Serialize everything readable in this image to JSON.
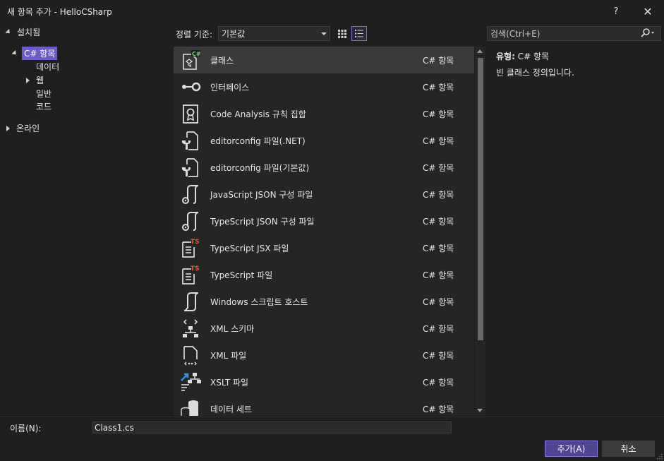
{
  "window": {
    "title": "새 항목 추가 - HelloCSharp",
    "help_label": "?",
    "close_label": "✕"
  },
  "tree": {
    "installed": "설치됨",
    "csharp_items": "C# 항목",
    "data": "데이터",
    "web": "웹",
    "general": "일반",
    "code": "코드",
    "online": "온라인"
  },
  "toolbar": {
    "sort_label": "정렬 기준:",
    "sort_value": "기본값",
    "search_placeholder": "검색(Ctrl+E)"
  },
  "items": [
    {
      "name": "클래스",
      "category": "C# 항목",
      "icon": "class-icon"
    },
    {
      "name": "인터페이스",
      "category": "C# 항목",
      "icon": "interface-icon"
    },
    {
      "name": "Code Analysis 규칙 집합",
      "category": "C# 항목",
      "icon": "ruleset-icon"
    },
    {
      "name": "editorconfig 파일(.NET)",
      "category": "C# 항목",
      "icon": "editorconfig-icon"
    },
    {
      "name": "editorconfig 파일(기본값)",
      "category": "C# 항목",
      "icon": "editorconfig-icon"
    },
    {
      "name": "JavaScript JSON 구성 파일",
      "category": "C# 항목",
      "icon": "script-file-icon"
    },
    {
      "name": "TypeScript JSON 구성 파일",
      "category": "C# 항목",
      "icon": "script-file-icon"
    },
    {
      "name": "TypeScript JSX 파일",
      "category": "C# 항목",
      "icon": "typescript-icon"
    },
    {
      "name": "TypeScript 파일",
      "category": "C# 항목",
      "icon": "typescript-icon"
    },
    {
      "name": "Windows 스크립트 호스트",
      "category": "C# 항목",
      "icon": "script-host-icon"
    },
    {
      "name": "XML 스키마",
      "category": "C# 항목",
      "icon": "xml-schema-icon"
    },
    {
      "name": "XML 파일",
      "category": "C# 항목",
      "icon": "xml-file-icon"
    },
    {
      "name": "XSLT 파일",
      "category": "C# 항목",
      "icon": "xslt-icon"
    },
    {
      "name": "데이터 세트",
      "category": "C# 항목",
      "icon": "dataset-icon"
    }
  ],
  "detail": {
    "type_label": "유형:",
    "type_value": "C# 항목",
    "description": "빈 클래스 정의입니다."
  },
  "footer": {
    "name_label": "이름(N):",
    "name_value": "Class1.cs",
    "add_label": "추가(A)",
    "cancel_label": "취소"
  },
  "colors": {
    "accent": "#6a5bc7",
    "background": "#1f1f1f",
    "list_background": "#252526",
    "typescript_badge": "#e8592c",
    "xslt_arrow": "#3c8fdc"
  }
}
